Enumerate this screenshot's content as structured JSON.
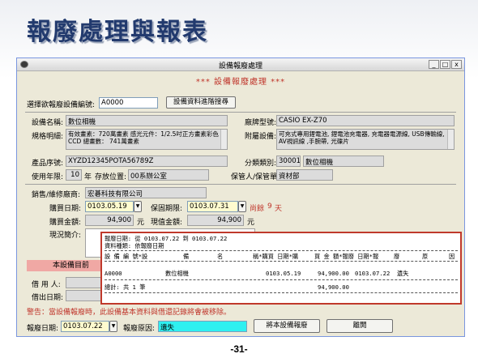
{
  "slide": {
    "title": "報廢處理與報表",
    "page": "-31-"
  },
  "window": {
    "title": "設備報廢處理",
    "header": "*** 設備報廢處理 ***",
    "controls": {
      "minimize": "_",
      "maximize": "□",
      "close": "x"
    }
  },
  "select": {
    "label": "選擇欲報廢設備編號:",
    "value": "A0000",
    "button": "設備資料進階搜尋"
  },
  "device": {
    "name_label": "設備名稱:",
    "name": "數位相機",
    "brand_label": "廠牌型號:",
    "brand": "CASIO EX-Z70",
    "spec_label": "規格明細:",
    "spec": "有效畫素：720萬畫素 感光元件：1/2.5吋正方畫素彩色CCD 總畫數： 741萬畫素",
    "accessory_label": "附屬設備:",
    "accessory": "可充式專用鋰電池, 鋰電池充電器, 充電器電源線, USB傳輸線, AV視訊線 ,手腕帶, 光碟片",
    "serial_label": "產品序號:",
    "serial": "XYZD12345POTA56789Z",
    "category_label": "分類類別:",
    "category_code": "30001",
    "category": "數位相機",
    "years_label": "使用年限:",
    "years": "10",
    "years_unit": "年",
    "location_label": "存放位置:",
    "location": "00系辦公室",
    "keeper_label": "保管人/保管單位:",
    "keeper": "資材部"
  },
  "vendor": {
    "label": "銷售/維修廠商:",
    "name": "宏碁科技有限公司",
    "buy_date_label": "購買日期:",
    "buy_date": "0103.05.19",
    "warranty_label": "保固期限:",
    "warranty": "0103.07.31",
    "remain_label": "尚餘",
    "remain_days": "9",
    "remain_unit": "天",
    "price_label": "購買金額:",
    "price": "94,900",
    "price_unit": "元",
    "value_label": "現值金額:",
    "value": "94,900",
    "value_unit": "元",
    "note_label": "現況簡介:"
  },
  "lower": {
    "panel_label": "本設備目前",
    "borrower_label": "借 用 人:",
    "borrow_date_label": "借出日期:",
    "warning": "警告：當設備報廢時，此設備基本資料與借還記錄將會被移除。",
    "scrap_date_label": "報廢日期:",
    "scrap_date": "0103.07.22",
    "reason_label": "報廢原因:",
    "reason": "遺失",
    "scrap_button": "將本設備報廢",
    "leave_button": "離開"
  },
  "report": {
    "line1": "報廢日期: 從 0103.07.22 到 0103.07.22",
    "line2": "資料種類: 依報廢日期",
    "headers": [
      "設 備 編 號*設",
      "備",
      "名",
      "稱*購買 日期*購",
      "買 金 額*報廢 日期*報",
      "廢",
      "原",
      "因"
    ],
    "row": {
      "id": "A0000",
      "name": "數位相機",
      "buy_date": "0103.05.19",
      "amount": "94,900.00",
      "scrap_date": "0103.07.22",
      "reason": "遺失"
    },
    "total_label": "總計: 共 1 筆",
    "total": "94,900.00"
  }
}
